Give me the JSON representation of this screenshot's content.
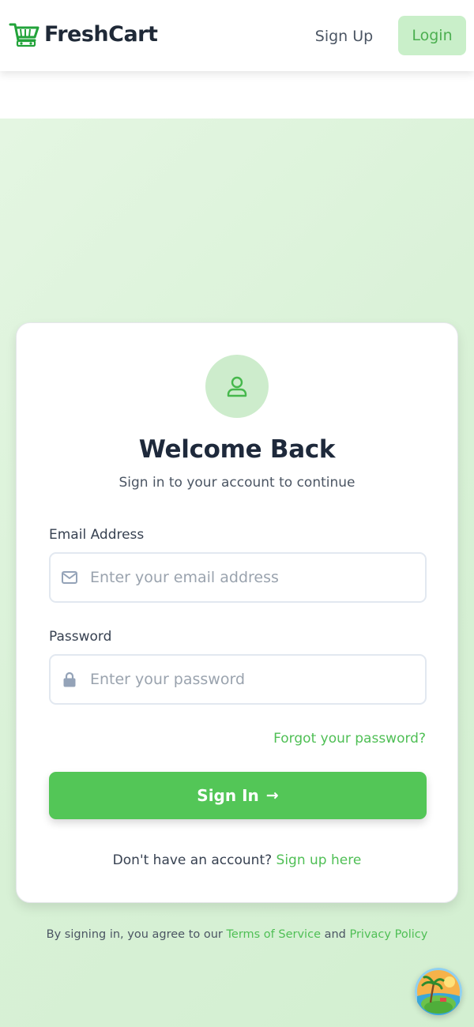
{
  "header": {
    "brand_name": "FreshCart",
    "brand_icon": "shopping-cart-icon",
    "signup_label": "Sign Up",
    "login_label": "Login"
  },
  "login_card": {
    "avatar_icon": "user-icon",
    "title": "Welcome Back",
    "subtitle": "Sign in to your account to continue",
    "email": {
      "label": "Email Address",
      "placeholder": "Enter your email address",
      "value": "",
      "icon": "envelope-icon"
    },
    "password": {
      "label": "Password",
      "placeholder": "Enter your password",
      "value": "",
      "icon": "lock-icon"
    },
    "forgot_label": "Forgot your password?",
    "submit_label": "Sign In",
    "submit_icon": "arrow-right-icon",
    "no_account_text": "Don't have an account?",
    "signup_link": "Sign up here"
  },
  "footer": {
    "prefix": "By signing in, you agree to our",
    "terms_link": "Terms of Service",
    "conjunction": "and",
    "privacy_link": "Privacy Policy"
  },
  "floating_badge": {
    "icon": "beach-island-icon"
  },
  "colors": {
    "brand_green": "#53c657",
    "link_green": "#4fbf55",
    "login_bg": "#c9efc9",
    "page_bg": "#dcf3da",
    "text_dark": "#1e293b"
  }
}
